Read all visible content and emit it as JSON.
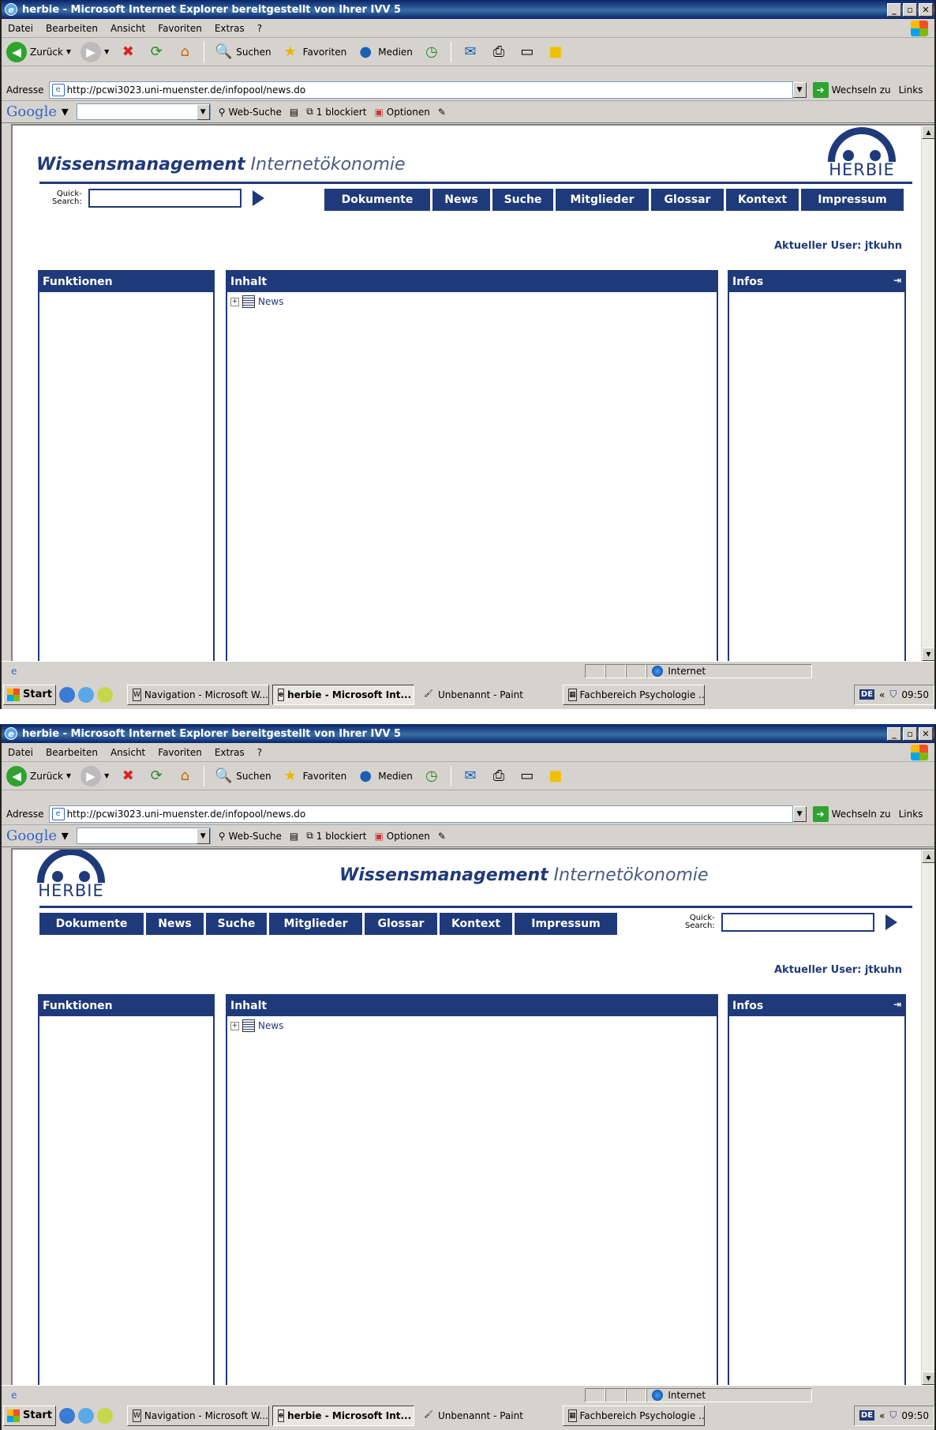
{
  "browser": {
    "title": "herbie - Microsoft Internet Explorer bereitgestellt von Ihrer IVV 5",
    "window_buttons": [
      "_",
      "̅",
      "X"
    ],
    "menu": [
      "Datei",
      "Bearbeiten",
      "Ansicht",
      "Favoriten",
      "Extras",
      "?"
    ],
    "toolbar": {
      "back": "Zurück",
      "search": "Suchen",
      "favorites": "Favoriten",
      "media": "Medien"
    },
    "address": {
      "label": "Adresse",
      "url": "http://pcwi3023.uni-muenster.de/infopool/news.do",
      "go": "Wechseln zu",
      "links": "Links"
    },
    "google": {
      "logo": "Google",
      "websearch": "Web-Suche",
      "blocked": "1 blockiert",
      "options": "Optionen"
    },
    "status": {
      "zone": "Internet"
    }
  },
  "taskbar": {
    "start": "Start",
    "tasks": [
      "Navigation - Microsoft W...",
      "herbie - Microsoft Int...",
      "Unbenannt - Paint",
      "Fachbereich Psychologie ..."
    ],
    "lang": "DE",
    "chevron": "«",
    "clock": "09:50"
  },
  "page": {
    "brand_bold": "Wissensmanagement",
    "brand_light": "Internetökonomie",
    "logo_text": "HERBIE",
    "quicksearch_label_1": "Quick-",
    "quicksearch_label_2": "Search:",
    "nav": [
      "Dokumente",
      "News",
      "Suche",
      "Mitglieder",
      "Glossar",
      "Kontext",
      "Impressum"
    ],
    "user": "Aktueller User: jtkuhn",
    "panels": {
      "functions": "Funktionen",
      "content": "Inhalt",
      "infos": "Infos"
    },
    "tree_item": "News"
  }
}
